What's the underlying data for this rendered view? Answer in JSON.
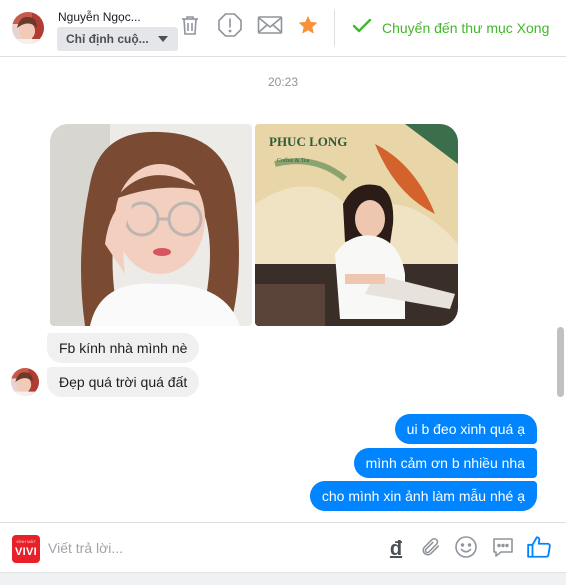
{
  "header": {
    "contact_name": "Nguyễn Ngọc...",
    "assign_label": "Chỉ định cuộ...",
    "move_to_done_label": "Chuyển đến thư mục Xong",
    "colors": {
      "done_green": "#42b72a",
      "star_orange": "#f7923b",
      "icon_gray": "#90949c"
    },
    "icons": [
      "trash-icon",
      "spam-icon",
      "mail-icon",
      "star-icon",
      "checkmark-icon"
    ]
  },
  "conversation": {
    "timestamp": "20:23",
    "incoming": [
      {
        "text": "Fb kính nhà mình nè"
      },
      {
        "text": "Đẹp quá trời quá đất"
      }
    ],
    "outgoing": [
      {
        "text": "ui b đeo xinh quá ạ"
      },
      {
        "text": "mình cảm ơn b nhiều nha"
      },
      {
        "text": "cho mình xin ảnh làm mẫu nhé ạ"
      }
    ],
    "photo_sign_text": "PHUC LONG",
    "photo_sign_subtext": "Coffee & Tea",
    "colors": {
      "outgoing_bubble": "#0084ff",
      "incoming_bubble": "#f1f0f0"
    }
  },
  "composer": {
    "brand_small": "KÍNH MẮT",
    "brand_big": "VIVI",
    "placeholder": "Viết trả lời...",
    "currency_symbol": "đ",
    "colors": {
      "brand_red": "#e8202a",
      "like_blue": "#0084ff"
    },
    "icons": [
      "currency-icon",
      "attachment-icon",
      "emoji-icon",
      "saved-replies-icon",
      "like-icon"
    ]
  }
}
